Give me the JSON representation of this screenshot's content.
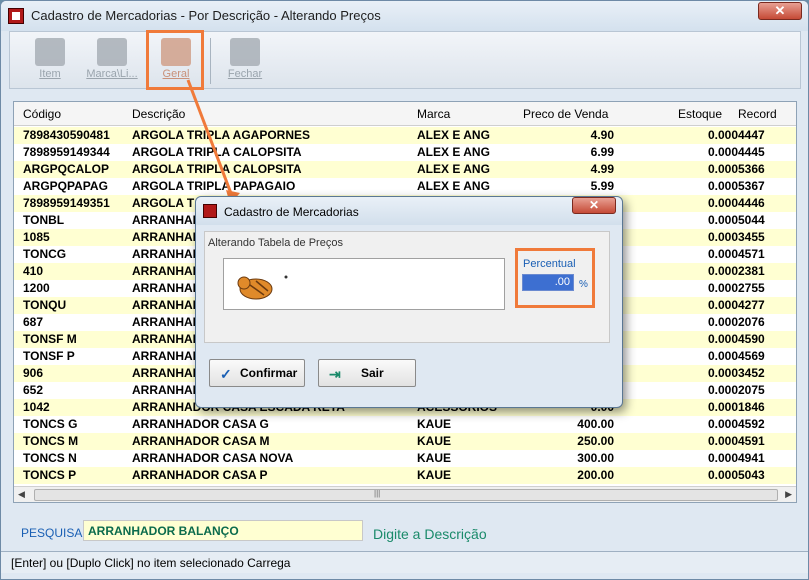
{
  "window": {
    "title": "Cadastro de Mercadorias - Por Descrição - Alterando Preços",
    "close": "✕"
  },
  "toolbar": {
    "buttons": [
      {
        "label": "Item",
        "icon": "item-icon"
      },
      {
        "label": "Marca\\Li...",
        "icon": "brand-icon"
      },
      {
        "label": "Geral",
        "icon": "general-icon"
      },
      {
        "label": "Fechar",
        "icon": "close-doc-icon"
      }
    ]
  },
  "grid": {
    "columns": [
      "Código",
      "Descrição",
      "Marca",
      "Preco de Venda",
      "Estoque",
      "Record"
    ],
    "rows": [
      [
        "7898430590481",
        "ARGOLA TRIPLA AGAPORNES",
        "ALEX E ANG",
        "4.90",
        "0.000",
        "4447"
      ],
      [
        "7898959149344",
        "ARGOLA TRIPLA CALOPSITA",
        "ALEX E ANG",
        "6.99",
        "0.000",
        "4445"
      ],
      [
        "ARGPQCALOP",
        "ARGOLA TRIPLA CALOPSITA",
        "ALEX E ANG",
        "4.99",
        "0.000",
        "5366"
      ],
      [
        "ARGPQPAPAG",
        "ARGOLA TRIPLA PAPAGAIO",
        "ALEX E ANG",
        "5.99",
        "0.000",
        "5367"
      ],
      [
        "7898959149351",
        "ARGOLA T",
        "",
        "",
        "0.000",
        "4446"
      ],
      [
        "TONBL",
        "ARRANHAD",
        "",
        "",
        "0.000",
        "5044"
      ],
      [
        "1085",
        "ARRANHAD",
        "",
        "",
        "0.000",
        "3455"
      ],
      [
        "TONCG",
        "ARRANHAD",
        "",
        "",
        "0.000",
        "4571"
      ],
      [
        "410",
        "ARRANHAD",
        "",
        "",
        "0.000",
        "2381"
      ],
      [
        "1200",
        "ARRANHAD",
        "",
        "",
        "0.000",
        "2755"
      ],
      [
        "TONQU",
        "ARRANHAD",
        "",
        "",
        "0.000",
        "4277"
      ],
      [
        "687",
        "ARRANHAD",
        "",
        "",
        "0.000",
        "2076"
      ],
      [
        "TONSF M",
        "ARRANHAD",
        "",
        "",
        "0.000",
        "4590"
      ],
      [
        "TONSF P",
        "ARRANHAD",
        "",
        "",
        "0.000",
        "4569"
      ],
      [
        "906",
        "ARRANHAD",
        "",
        "",
        "0.000",
        "3452"
      ],
      [
        "652",
        "ARRANHAD",
        "",
        "",
        "0.000",
        "2075"
      ],
      [
        "1042",
        "ARRANHADOR CASA ESCADA RETA",
        "ACESSORIOS",
        "0.00",
        "0.000",
        "1846"
      ],
      [
        "TONCS G",
        "ARRANHADOR CASA G",
        "KAUE",
        "400.00",
        "0.000",
        "4592"
      ],
      [
        "TONCS M",
        "ARRANHADOR CASA M",
        "KAUE",
        "250.00",
        "0.000",
        "4591"
      ],
      [
        "TONCS N",
        "ARRANHADOR CASA NOVA",
        "KAUE",
        "300.00",
        "0.000",
        "4941"
      ],
      [
        "TONCS P",
        "ARRANHADOR CASA P",
        "KAUE",
        "200.00",
        "0.000",
        "5043"
      ]
    ]
  },
  "search": {
    "label": "PESQUISA",
    "value": "ARRANHADOR BALANÇO",
    "hint": "Digite a Descrição"
  },
  "status": "[Enter] ou [Duplo Click] no item selecionado Carrega",
  "dialog": {
    "title": "Cadastro de Mercadorias",
    "group_label": "Alterando Tabela de Preços",
    "percent_label": "Percentual",
    "percent_value": ".00",
    "percent_symbol": "%",
    "confirm": "Confirmar",
    "exit": "Sair",
    "close": "✕"
  },
  "colors": {
    "accent": "#f07a3a",
    "row_highlight": "#ffffd2",
    "title_red": "#b01818"
  }
}
